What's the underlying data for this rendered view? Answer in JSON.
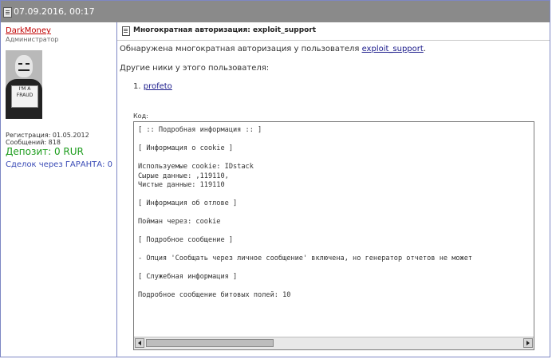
{
  "header": {
    "date": "07.09.2016, 00:17"
  },
  "user": {
    "name": "DarkMoney",
    "role": "Администратор",
    "avatar_text": "I'M A\nFRAUD",
    "registration": "Регистрация: 01.05.2012",
    "messages": "Сообщений: 818",
    "deposit": "Депозит: 0 RUR",
    "guarantee": "Сделок через ГАРАНТА: 0"
  },
  "post": {
    "title": "Многократная авторизация: exploit_support",
    "detected_prefix": "Обнаружена многократная авторизация у пользователя ",
    "detected_user": "exploit_support",
    "detected_suffix": ".",
    "other_nicks_label": "Другие ники у этого пользователя:",
    "other_nicks": [
      "profeto"
    ],
    "nick_number": "1."
  },
  "code": {
    "label": "Код:",
    "content": "[ :: Подробная информация :: ]\n\n[ Информация о cookie ]\n\nИспользуемые cookie: IDstack\nСырые данные: ,119110,\nЧистые данные: 119110\n\n[ Информация об отлове ]\n\nПойман через: cookie\n\n[ Подробное сообщение ]\n\n- Опция 'Сообщать через личное сообщение' включена, но генератор отчетов не может\n\n[ Служебная информация ]\n\nПодробное сообщение битовых полей: 10"
  },
  "icons": {
    "header": "post-icon",
    "title": "document-icon",
    "scroll_left": "arrow-left-icon",
    "scroll_right": "arrow-right-icon"
  },
  "colors": {
    "header_bg": "#8a8a8a",
    "username": "#c00000",
    "deposit": "#1c9c1c",
    "guarantee": "#3a4bb6",
    "border": "#7d87c4"
  }
}
